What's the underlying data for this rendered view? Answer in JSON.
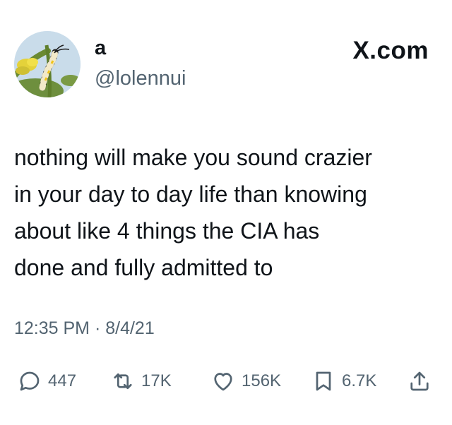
{
  "user": {
    "display_name": "a",
    "handle": "@lolennui",
    "avatar_icon": "caterpillar-on-plant-icon"
  },
  "brand": {
    "label": "X.com"
  },
  "tweet": {
    "lines": [
      "nothing will make you sound crazier",
      "in your day to day life than knowing",
      "about like 4 things the CIA has",
      "done and fully admitted to"
    ],
    "timestamp": "12:35 PM · 8/4/21"
  },
  "actions": {
    "reply": {
      "icon": "reply-icon",
      "count": "447"
    },
    "repost": {
      "icon": "repost-icon",
      "count": "17K"
    },
    "like": {
      "icon": "heart-icon",
      "count": "156K"
    },
    "bookmark": {
      "icon": "bookmark-icon",
      "count": "6.7K"
    },
    "share": {
      "icon": "share-icon"
    }
  },
  "colors": {
    "text_primary": "#0f1419",
    "text_secondary": "#536471",
    "icon": "#536471"
  }
}
